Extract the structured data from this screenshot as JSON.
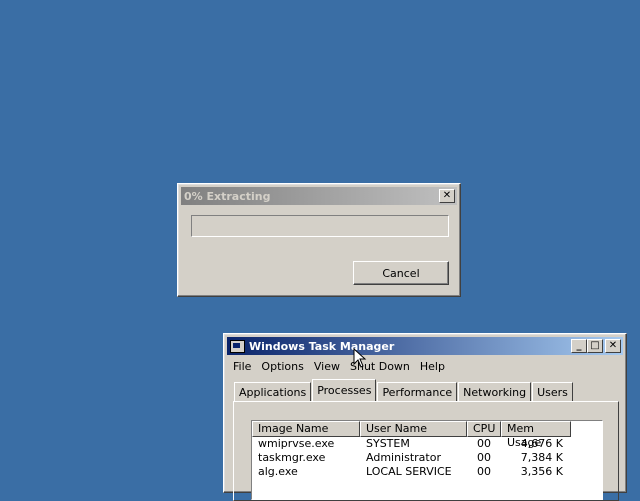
{
  "desktop": {
    "background": "#3a6ea5"
  },
  "extract_dialog": {
    "title": "0% Extracting",
    "close_glyph": "✕",
    "progress": 0,
    "cancel_label": "Cancel"
  },
  "task_manager": {
    "title": "Windows Task Manager",
    "window_buttons": {
      "minimize": "_",
      "maximize": "□",
      "close": "✕"
    },
    "menu": [
      "File",
      "Options",
      "View",
      "Shut Down",
      "Help"
    ],
    "tabs": [
      "Applications",
      "Processes",
      "Performance",
      "Networking",
      "Users"
    ],
    "selected_tab": "Processes",
    "columns": [
      "Image Name",
      "User Name",
      "CPU",
      "Mem Usage"
    ],
    "processes": [
      {
        "image": "wmiprvse.exe",
        "user": "SYSTEM",
        "cpu": "00",
        "mem": "4,676 K"
      },
      {
        "image": "taskmgr.exe",
        "user": "Administrator",
        "cpu": "00",
        "mem": "7,384 K"
      },
      {
        "image": "alg.exe",
        "user": "LOCAL SERVICE",
        "cpu": "00",
        "mem": "3,356 K"
      }
    ]
  }
}
